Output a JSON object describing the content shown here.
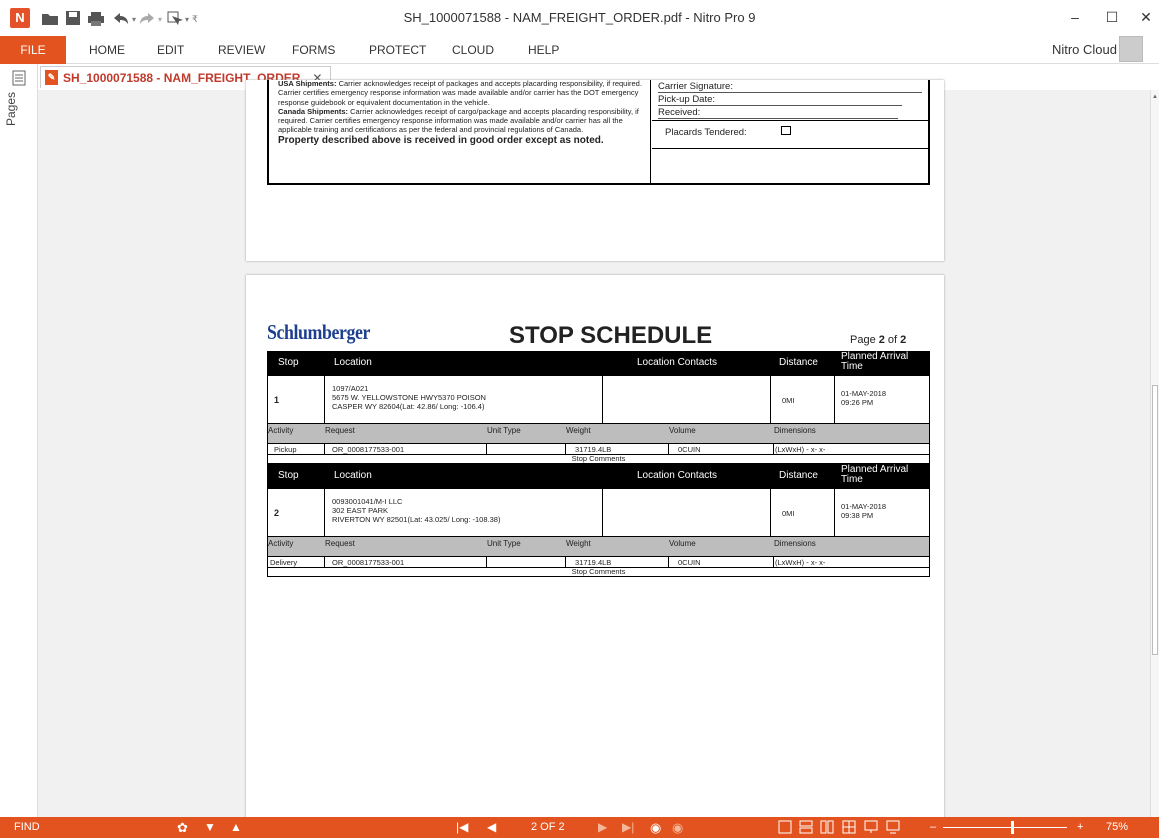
{
  "window": {
    "title": "SH_1000071588 - NAM_FREIGHT_ORDER.pdf - Nitro Pro 9",
    "minimize": "–",
    "maximize": "☐",
    "close": "✕"
  },
  "ribbon": {
    "file": "FILE",
    "tabs": [
      "HOME",
      "EDIT",
      "REVIEW",
      "FORMS",
      "PROTECT",
      "CLOUD",
      "HELP"
    ],
    "account": "Nitro Cloud"
  },
  "sidebar": {
    "pages": "Pages"
  },
  "doc_tab": {
    "label": "SH_1000071588 - NAM_FREIGHT_ORDER",
    "close": "✕"
  },
  "page1": {
    "usa_title": "USA Shipments:",
    "usa_text": "Carrier acknowledges receipt of packages and accepts placarding responsibility, if required. Carrier certifies emergency response information was made available and/or carrier has the DOT emergency response guidebook or equivalent documentation in the vehicle.",
    "canada_title": "Canada Shipments:",
    "canada_text": "Carrier acknowledges receipt of cargo/package and accepts placarding responsibility, if required. Carrier certifies emergency response information was made available and/or carrier has all the applicable training and certifications as per the federal and provincial regulations of Canada.",
    "property": "Property described above is received in good order except as noted.",
    "carrier_sig": "Carrier Signature:",
    "pickup_date": "Pick-up Date:",
    "received": "Received:",
    "placards": "Placards Tendered:"
  },
  "page2": {
    "logo": "Schlumberger",
    "title": "STOP SCHEDULE",
    "page_prefix": "Page ",
    "page_num": "2",
    "page_of": " of ",
    "page_total": "2",
    "headers": {
      "stop": "Stop",
      "location": "Location",
      "contacts": "Location Contacts",
      "distance": "Distance",
      "arrival": "Planned Arrival Time"
    },
    "sub_headers": {
      "activity": "Activity",
      "request": "Request",
      "unit_type": "Unit Type",
      "weight": "Weight",
      "volume": "Volume",
      "dimensions": "Dimensions"
    },
    "stop_comments": "Stop Comments",
    "stops": [
      {
        "num": "1",
        "loc1": "1097/A021",
        "loc2": "5675 W. YELLOWSTONE HWY5370 POISON",
        "loc3": "CASPER WY 82604(Lat: 42.86/ Long: -106.4)",
        "distance": "0MI",
        "arrival1": "01-MAY-2018",
        "arrival2": "09:26 PM",
        "activity": "Pickup",
        "request": "OR_0008177533-001",
        "unit_type": "",
        "weight": "31719.4LB",
        "volume": "0CUIN",
        "dimensions": "(LxWxH) - x- x-"
      },
      {
        "num": "2",
        "loc1": "0093001041/M-I LLC",
        "loc2": "302 EAST PARK",
        "loc3": "RIVERTON WY 82501(Lat: 43.025/ Long: -108.38)",
        "distance": "0MI",
        "arrival1": "01-MAY-2018",
        "arrival2": "09:38 PM",
        "activity": "Delivery",
        "request": "OR_0008177533-001",
        "unit_type": "",
        "weight": "31719.4LB",
        "volume": "0CUIN",
        "dimensions": "(LxWxH) - x- x-"
      }
    ]
  },
  "statusbar": {
    "find": "FIND",
    "page_indicator": "2 OF 2",
    "zoom": "75%",
    "zoom_minus": "–",
    "zoom_plus": "+"
  }
}
